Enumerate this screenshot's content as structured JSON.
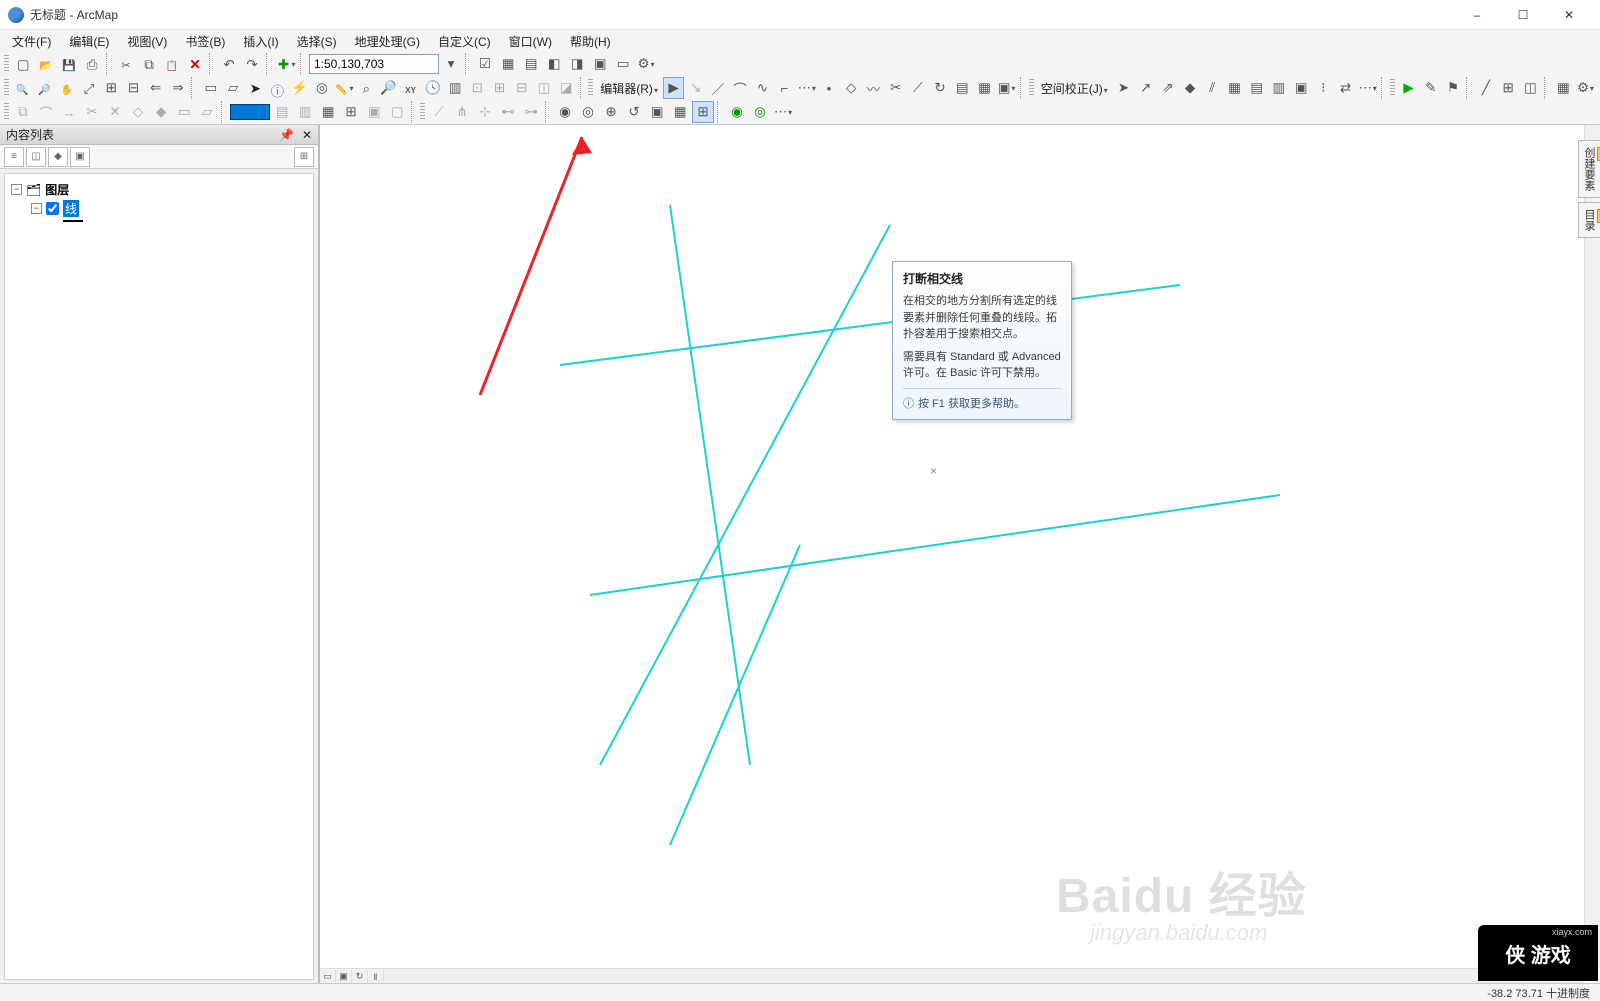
{
  "window": {
    "title": "无标题 - ArcMap",
    "minimize": "–",
    "maximize": "☐",
    "close": "✕"
  },
  "menu": {
    "items": [
      "文件(F)",
      "编辑(E)",
      "视图(V)",
      "书签(B)",
      "插入(I)",
      "选择(S)",
      "地理处理(G)",
      "自定义(C)",
      "窗口(W)",
      "帮助(H)"
    ]
  },
  "toolbar": {
    "scale_value": "1:50,130,703",
    "editor_label": "编辑器(R)",
    "spatial_adjust_label": "空间校正(J)"
  },
  "toc": {
    "title": "内容列表",
    "root": "图层",
    "layer_name": "线"
  },
  "tooltip": {
    "title": "打断相交线",
    "body1": "在相交的地方分割所有选定的线要素并删除任何重叠的线段。拓扑容差用于搜索相交点。",
    "body2": "需要具有 Standard 或 Advanced 许可。在 Basic 许可下禁用。",
    "footer": "按 F1 获取更多帮助。"
  },
  "statusbar": {
    "coords": "-38.2  73.71 十进制度"
  },
  "right_tabs": [
    "创建要素",
    "目录"
  ],
  "watermarks": {
    "baidu": "Baidu 经验",
    "url": "jingyan.baidu.com",
    "xia": "侠 游戏",
    "xia_url": "xiayx.com"
  }
}
